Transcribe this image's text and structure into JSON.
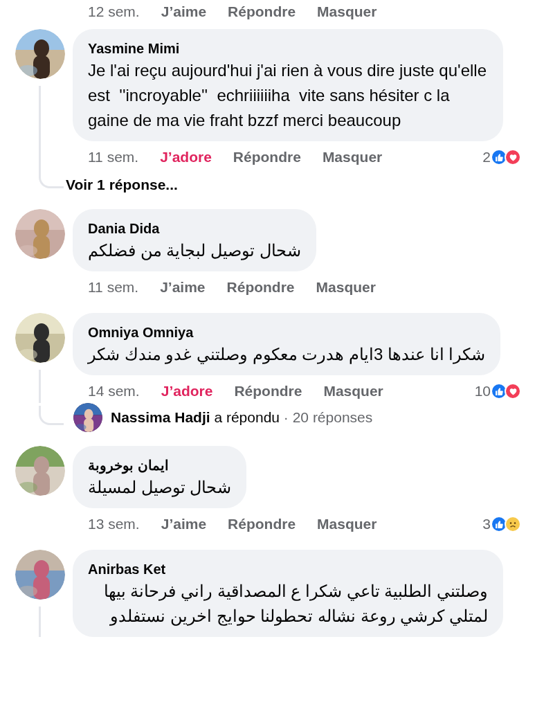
{
  "top_actions": {
    "time": "12 sem.",
    "like": {
      "label": "J’aime",
      "selected": false
    },
    "reply": "Répondre",
    "hide": "Masquer"
  },
  "comments": [
    {
      "name": "Yasmine Mimi",
      "text": "Je l'ai reçu aujourd'hui j'ai rien à vous dire juste qu'elle est  ''incroyable''  echriiiiiiha  vite sans hésiter c la gaine de ma vie fraht bzzf merci beaucoup",
      "time": "11 sem.",
      "like": {
        "label": "J’adore",
        "selected": true
      },
      "reply": "Répondre",
      "hide": "Masquer",
      "count": "2",
      "reactions": [
        {
          "kind": "like"
        },
        {
          "kind": "love"
        }
      ],
      "thread": {
        "kind": "more",
        "label": "Voir 1 réponse..."
      }
    },
    {
      "name": "Dania Dida",
      "text": "شحال توصيل لبجاية من فضلكم",
      "time": "11 sem.",
      "like": {
        "label": "J’aime",
        "selected": false
      },
      "reply": "Répondre",
      "hide": "Masquer"
    },
    {
      "name": "Omniya Omniya",
      "text": "شكرا انا عندها 3ايام هدرت معكوم وصلتني غدو مندك شكر",
      "time": "14 sem.",
      "like": {
        "label": "J’adore",
        "selected": true
      },
      "reply": "Répondre",
      "hide": "Masquer",
      "count": "10",
      "reactions": [
        {
          "kind": "like"
        },
        {
          "kind": "love"
        }
      ],
      "thread": {
        "kind": "reply",
        "author": "Nassima Hadji",
        "verb": "a répondu",
        "count": "· 20 réponses"
      }
    },
    {
      "name": "ايمان بوخروبة",
      "text": "شحال توصيل لمسيلة",
      "time": "13 sem.",
      "like": {
        "label": "J’aime",
        "selected": false
      },
      "reply": "Répondre",
      "hide": "Masquer",
      "count": "3",
      "reactions": [
        {
          "kind": "like"
        },
        {
          "kind": "sad"
        }
      ]
    },
    {
      "name": "Anirbas Ket",
      "text": "وصلتني الطلبية تاعي شكرا ع المصداقية راني فرحانة بيها لمتلي كرشي روعة نشاله تحطولنا حوايج اخرين نستفلدو",
      "has_replies": true
    }
  ]
}
